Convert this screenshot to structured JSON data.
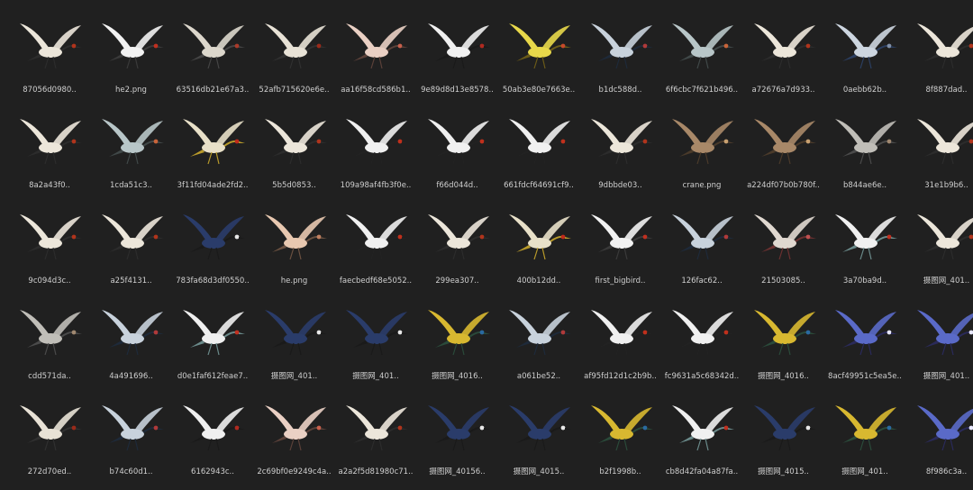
{
  "files": [
    {
      "name": "87056d0980..",
      "icon": "crane-flying-icon"
    },
    {
      "name": "he2.png",
      "icon": "crane-wings-up-icon"
    },
    {
      "name": "63516db21e67a3..",
      "icon": "small-birds-pair-icon"
    },
    {
      "name": "52afb715620e6e..",
      "icon": "cranes-flock-icon"
    },
    {
      "name": "aa16f58cd586b1..",
      "icon": "pink-crane-icon"
    },
    {
      "name": "9e89d8d13e8578..",
      "icon": "cranes-reflection-icon"
    },
    {
      "name": "50ab3e80e7663e..",
      "icon": "golden-crane-icon"
    },
    {
      "name": "b1dc588d..",
      "icon": "swallows-pair-icon"
    },
    {
      "name": "6f6cbc7f621b496..",
      "icon": "small-birds-icon"
    },
    {
      "name": "a72676a7d933..",
      "icon": "crane-flying-icon"
    },
    {
      "name": "0aebb62b..",
      "icon": "eagle-icon"
    },
    {
      "name": "8f887dad..",
      "icon": "crane-flying-icon"
    },
    {
      "name": "8a2a43f0..",
      "icon": "crane-flying-icon"
    },
    {
      "name": "1cda51c3..",
      "icon": "small-birds-icon"
    },
    {
      "name": "3f11fd04ade2fd2..",
      "icon": "cranes-standing-icon"
    },
    {
      "name": "5b5d0853..",
      "icon": "crane-flying-icon"
    },
    {
      "name": "109a98af4fb3f0e..",
      "icon": "crane-standing-icon"
    },
    {
      "name": "f66d044d..",
      "icon": "crane-standing-icon"
    },
    {
      "name": "661fdcf64691cf9..",
      "icon": "crane-standing-icon"
    },
    {
      "name": "9dbbde03..",
      "icon": "crane-flying-icon"
    },
    {
      "name": "crane.png",
      "icon": "sparrows-flock-icon"
    },
    {
      "name": "a224df07b0b780f..",
      "icon": "sparrows-flock-icon"
    },
    {
      "name": "b844ae6e..",
      "icon": "small-bird-icon"
    },
    {
      "name": "31e1b9b6..",
      "icon": "crane-flying-icon"
    },
    {
      "name": "9c094d3c..",
      "icon": "crane-flying-icon"
    },
    {
      "name": "a25f4131..",
      "icon": "crane-flying-icon"
    },
    {
      "name": "783fa68d3df0550..",
      "icon": "magpie-icon"
    },
    {
      "name": "he.png",
      "icon": "birds-flock-icon"
    },
    {
      "name": "faecbedf68e5052..",
      "icon": "crane-standing-icon"
    },
    {
      "name": "299ea307..",
      "icon": "crane-flying-icon"
    },
    {
      "name": "400b12dd..",
      "icon": "cranes-standing-icon"
    },
    {
      "name": "first_bigbird..",
      "icon": "crane-wings-up-icon"
    },
    {
      "name": "126fac62..",
      "icon": "swallows-pair-icon"
    },
    {
      "name": "21503085..",
      "icon": "swallow-icon"
    },
    {
      "name": "3a70ba9d..",
      "icon": "crane-dancing-icon"
    },
    {
      "name": "摄图网_401..",
      "icon": "crane-flying-icon"
    },
    {
      "name": "cdd571da..",
      "icon": "small-bird-icon"
    },
    {
      "name": "4a491696..",
      "icon": "swallows-pair-icon"
    },
    {
      "name": "d0e1faf612feae7..",
      "icon": "crane-dancing-icon"
    },
    {
      "name": "摄图网_401..",
      "icon": "magpie-icon"
    },
    {
      "name": "摄图网_401..",
      "icon": "magpie-icon"
    },
    {
      "name": "摄图网_4016..",
      "icon": "colorful-bird-icon"
    },
    {
      "name": "a061be52..",
      "icon": "swallows-pair-icon"
    },
    {
      "name": "af95fd12d1c2b9b..",
      "icon": "crane-standing-icon"
    },
    {
      "name": "fc9631a5c68342d..",
      "icon": "crane-standing-icon"
    },
    {
      "name": "摄图网_4016..",
      "icon": "colorful-bird-icon"
    },
    {
      "name": "8acf49951c5ea5e..",
      "icon": "blue-bird-icon"
    },
    {
      "name": "摄图网_401..",
      "icon": "blue-bird-icon"
    },
    {
      "name": "272d70ed..",
      "icon": "cranes-flock-icon"
    },
    {
      "name": "b74c60d1..",
      "icon": "swallows-pair-icon"
    },
    {
      "name": "6162943c..",
      "icon": "cranes-reflection-icon"
    },
    {
      "name": "2c69bf0e9249c4a..",
      "icon": "pink-crane-icon"
    },
    {
      "name": "a2a2f5d81980c71..",
      "icon": "crane-flying-icon"
    },
    {
      "name": "摄图网_40156..",
      "icon": "magpie-icon"
    },
    {
      "name": "摄图网_4015..",
      "icon": "magpie-icon"
    },
    {
      "name": "b2f1998b..",
      "icon": "colorful-bird-icon"
    },
    {
      "name": "cb8d42fa04a87fa..",
      "icon": "crane-dancing-icon"
    },
    {
      "name": "摄图网_4015..",
      "icon": "magpie-icon"
    },
    {
      "name": "摄图网_401..",
      "icon": "colorful-bird-icon"
    },
    {
      "name": "8f986c3a..",
      "icon": "blue-bird-icon"
    }
  ],
  "colors": {
    "background": "#202020",
    "caption": "#cfcfcf"
  }
}
